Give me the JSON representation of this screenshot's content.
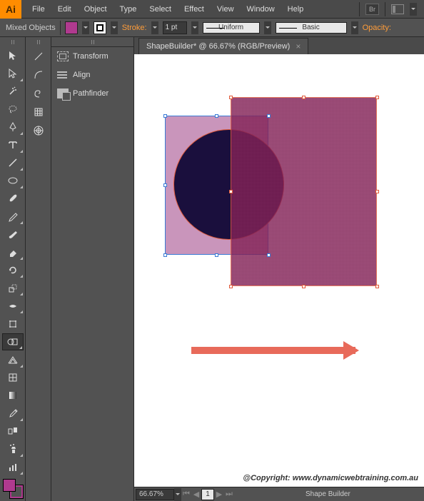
{
  "app": {
    "logo": "Ai"
  },
  "menu": [
    "File",
    "Edit",
    "Object",
    "Type",
    "Select",
    "Effect",
    "View",
    "Window",
    "Help"
  ],
  "menuRight": {
    "br": "Br"
  },
  "control": {
    "selection": "Mixed Objects",
    "stroke_label": "Stroke:",
    "stroke_weight": "1 pt",
    "stroke_profile": "Uniform",
    "brush": "Basic",
    "opacity_label": "Opacity:"
  },
  "panels": {
    "transform": "Transform",
    "align": "Align",
    "pathfinder": "Pathfinder"
  },
  "document": {
    "tab_title": "ShapeBuilder* @ 66.67% (RGB/Preview)",
    "copyright": "@Copyright: www.dynamicwebtraining.com.au"
  },
  "status": {
    "zoom": "66.67%",
    "page": "1",
    "tool": "Shape Builder"
  }
}
